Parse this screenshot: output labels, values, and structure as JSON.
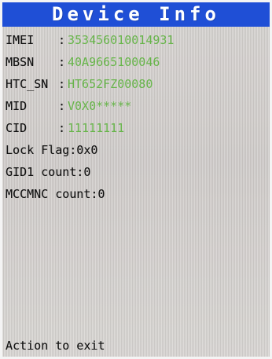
{
  "header": {
    "title": "Device Info"
  },
  "device_info": {
    "imei_label": "IMEI",
    "imei_value": "353456010014931",
    "mbsn_label": "MBSN",
    "mbsn_value": "40A9665100046",
    "htc_sn_label": "HTC_SN",
    "htc_sn_value": "HT652FZ00080",
    "mid_label": "MID",
    "mid_value": "V0X0*****",
    "cid_label": "CID",
    "cid_value": "11111111",
    "separator": ":"
  },
  "counters": {
    "lock_flag": "Lock Flag:0x0",
    "gid1_count": "GID1 count:0",
    "mccmnc_count": "MCCMNC count:0"
  },
  "footer": {
    "text": "Action to exit"
  },
  "colors": {
    "header_bg": "#1f4fd6",
    "value_green": "#67b54a",
    "screen_bg": "#d3d0cd",
    "text": "#111111"
  }
}
